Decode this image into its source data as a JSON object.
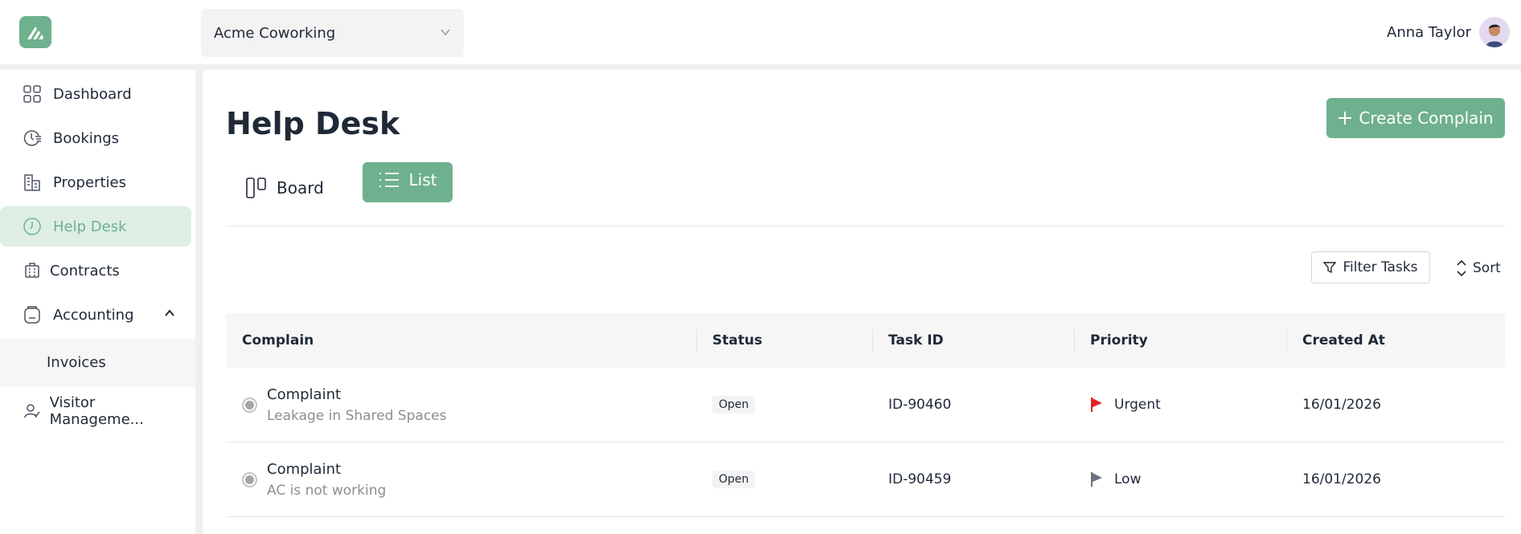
{
  "app": {
    "workspace": "Acme Coworking",
    "user_name": "Anna Taylor"
  },
  "sidebar": {
    "items": [
      {
        "label": "Dashboard",
        "icon": "grid-icon"
      },
      {
        "label": "Bookings",
        "icon": "clock-list-icon"
      },
      {
        "label": "Properties",
        "icon": "building-icon"
      },
      {
        "label": "Help Desk",
        "icon": "help-clock-icon",
        "active": true
      },
      {
        "label": "Contracts",
        "icon": "contract-building-icon"
      },
      {
        "label": "Accounting",
        "icon": "wallet-icon",
        "expanded": true
      },
      {
        "label": "Visitor Manageme...",
        "icon": "visitor-icon"
      }
    ],
    "sub_items": [
      {
        "label": "Invoices"
      }
    ]
  },
  "main": {
    "title": "Help Desk",
    "create_label": "Create Complain",
    "views": {
      "board_label": "Board",
      "list_label": "List",
      "active": "List"
    },
    "filter_label": "Filter Tasks",
    "sort_label": "Sort"
  },
  "table": {
    "columns": [
      "Complain",
      "Status",
      "Task ID",
      "Priority",
      "Created At"
    ],
    "rows": [
      {
        "title": "Complaint",
        "subtitle": "Leakage in Shared Spaces",
        "status": "Open",
        "task_id": "ID-90460",
        "priority": "Urgent",
        "created_at": "16/01/2026"
      },
      {
        "title": "Complaint",
        "subtitle": "AC is not working",
        "status": "Open",
        "task_id": "ID-90459",
        "priority": "Low",
        "created_at": "16/01/2026"
      }
    ]
  },
  "colors": {
    "accent": "#6fb08f",
    "accent_light": "#deeee4",
    "urgent_flag": "#e02424",
    "low_flag": "#6b7280"
  }
}
